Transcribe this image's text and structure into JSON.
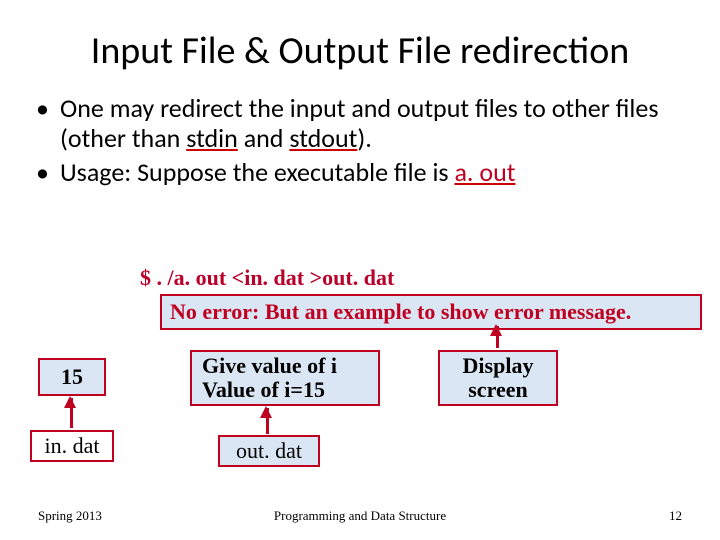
{
  "title": "Input File & Output File redirection",
  "bullet1_a": "One may redirect the input and output files to other files (other than ",
  "bullet1_u1": "stdin",
  "bullet1_mid": " and ",
  "bullet1_u2": "stdout",
  "bullet1_end": ").",
  "bullet2_a": "Usage: Suppose the executable file is ",
  "bullet2_red": "a. out",
  "cmd": "$ . /a. out  <in. dat   >out. dat",
  "errmsg": "No error: But an example to show error message.",
  "box15": "15",
  "boxout_l1": "Give value of i",
  "boxout_l2": "Value of i=15",
  "boxdisp_l1": "Display",
  "boxdisp_l2": "screen",
  "indat": "in. dat",
  "outdat": "out. dat",
  "footer_l": "Spring 2013",
  "footer_c": "Programming and Data Structure",
  "footer_r": "12"
}
